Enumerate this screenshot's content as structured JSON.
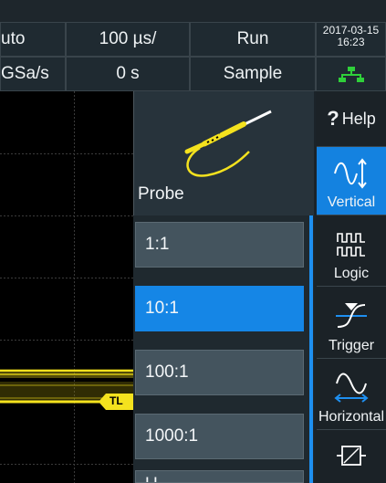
{
  "status": {
    "trigger_mode": "uto",
    "timebase": "100 µs/",
    "run_state": "Run",
    "date": "2017-03-15",
    "time": "16:23",
    "sample_rate": "GSa/s",
    "offset": "0 s",
    "acq_mode": "Sample"
  },
  "waveform": {
    "trigger_level_label": "TL",
    "trace_color": "#f4e21e"
  },
  "probe": {
    "title": "Probe",
    "options": [
      "1:1",
      "10:1",
      "100:1",
      "1000:1"
    ],
    "selected": "10:1",
    "partial_next": "U"
  },
  "menu": {
    "help_mark": "?",
    "help_label": "Help",
    "items": [
      {
        "label": "Vertical",
        "icon": "vertical-sine-icon",
        "selected": true
      },
      {
        "label": "Logic",
        "icon": "logic-pulse-icon",
        "selected": false
      },
      {
        "label": "Trigger",
        "icon": "trigger-edge-icon",
        "selected": false
      },
      {
        "label": "Horizontal",
        "icon": "horizontal-sine-icon",
        "selected": false
      }
    ]
  },
  "colors": {
    "accent": "#1586e6",
    "trace": "#f4e21e",
    "network": "#2fd03a"
  }
}
